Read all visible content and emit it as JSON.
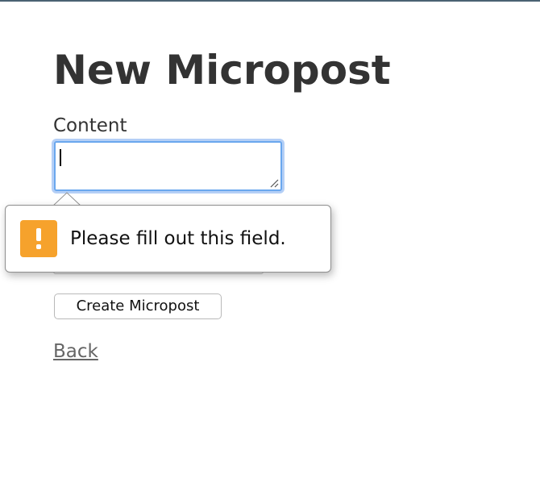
{
  "page": {
    "title": "New Micropost"
  },
  "form": {
    "content_label": "Content",
    "content_value": "",
    "submit_label": "Create Micropost"
  },
  "nav": {
    "back_label": "Back"
  },
  "validation": {
    "message": "Please fill out this field.",
    "icon": "warning-icon",
    "icon_color": "#f6a22c"
  },
  "colors": {
    "focus_ring": "#6aa7ee",
    "link": "#666666",
    "text": "#333333"
  }
}
